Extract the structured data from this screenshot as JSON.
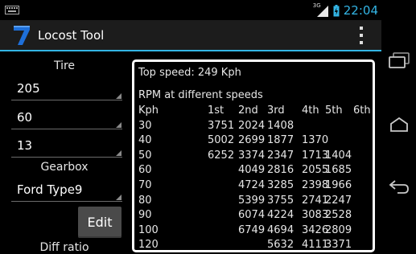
{
  "status_bar": {
    "network_type": "3G",
    "time": "22:04"
  },
  "action_bar": {
    "title": "Locost Tool"
  },
  "form": {
    "tire_label": "Tire",
    "tire_width": "205",
    "tire_aspect": "60",
    "rim_size": "13",
    "gearbox_label": "Gearbox",
    "gearbox": "Ford Type9",
    "edit_label": "Edit",
    "diff_label": "Diff ratio"
  },
  "results": {
    "top_speed": "Top speed: 249 Kph",
    "rpm_title": "RPM at different speeds",
    "columns": [
      "Kph",
      "1st",
      "2nd",
      "3rd",
      "4th",
      "5th",
      "6th"
    ],
    "rows": [
      [
        "30",
        "3751",
        "2024",
        "1408",
        "",
        "",
        ""
      ],
      [
        "40",
        "5002",
        "2699",
        "1877",
        "1370",
        "",
        ""
      ],
      [
        "50",
        "6252",
        "3374",
        "2347",
        "1713",
        "1404",
        ""
      ],
      [
        "60",
        "",
        "4049",
        "2816",
        "2055",
        "1685",
        ""
      ],
      [
        "70",
        "",
        "4724",
        "3285",
        "2398",
        "1966",
        ""
      ],
      [
        "80",
        "",
        "5399",
        "3755",
        "2741",
        "2247",
        ""
      ],
      [
        "90",
        "",
        "6074",
        "4224",
        "3083",
        "2528",
        ""
      ],
      [
        "100",
        "",
        "6749",
        "4694",
        "3426",
        "2809",
        ""
      ],
      [
        "120",
        "",
        "",
        "5632",
        "4111",
        "3371",
        ""
      ]
    ]
  },
  "colors": {
    "accent": "#33b5e5",
    "app_logo": "#1e6fd9"
  }
}
